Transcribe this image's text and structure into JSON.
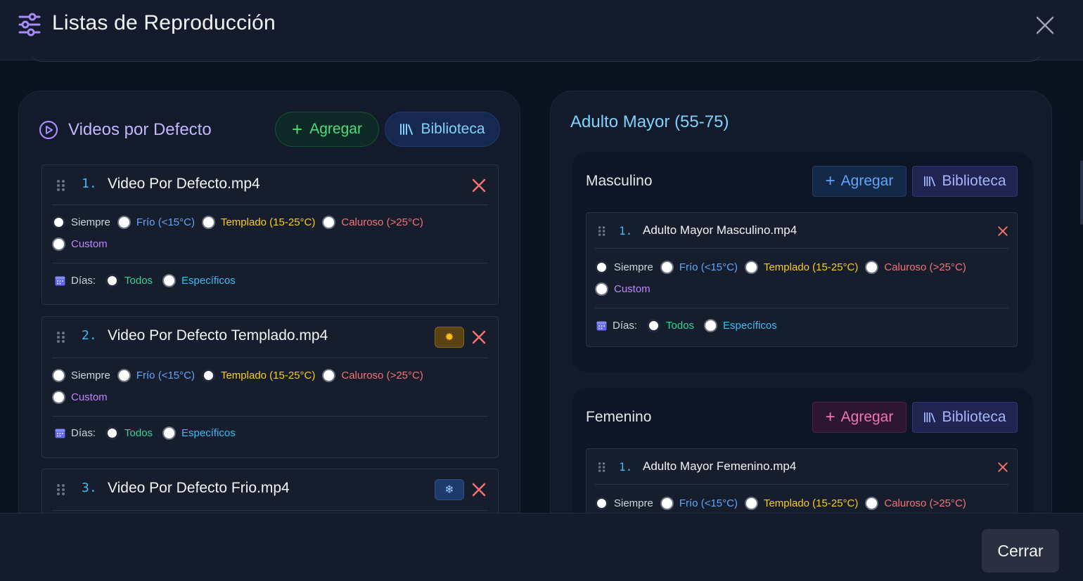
{
  "header": {
    "title": "Listas de Reproducción"
  },
  "weather_options": {
    "siempre": "Siempre",
    "frio": "Frío (<15°C)",
    "templado": "Templado (15-25°C)",
    "caluroso": "Caluroso (>25°C)",
    "custom": "Custom"
  },
  "days_options": {
    "label": "Días:",
    "todos": "Todos",
    "especificos": "Específicos"
  },
  "left_panel": {
    "title": "Videos por Defecto",
    "add_label": "Agregar",
    "library_label": "Biblioteca",
    "videos": [
      {
        "num": "1.",
        "name": "Video Por Defecto.mp4",
        "selected_weather": "siempre",
        "selected_days": "todos",
        "badge": ""
      },
      {
        "num": "2.",
        "name": "Video Por Defecto Templado.mp4",
        "selected_weather": "templado",
        "selected_days": "todos",
        "badge": "sun-icon"
      },
      {
        "num": "3.",
        "name": "Video Por Defecto Frio.mp4",
        "selected_weather": "",
        "selected_days": "",
        "badge": "snowflake-icon"
      }
    ]
  },
  "right_panel": {
    "title": "Adulto Mayor (55-75)",
    "groups": [
      {
        "title": "Masculino",
        "add_label": "Agregar",
        "library_label": "Biblioteca",
        "videos": [
          {
            "num": "1.",
            "name": "Adulto Mayor Masculino.mp4",
            "selected_weather": "siempre",
            "selected_days": "todos"
          }
        ]
      },
      {
        "title": "Femenino",
        "add_label": "Agregar",
        "library_label": "Biblioteca",
        "videos": [
          {
            "num": "1.",
            "name": "Adulto Mayor Femenino.mp4",
            "selected_weather": "siempre",
            "selected_days": ""
          }
        ]
      }
    ]
  },
  "footer": {
    "close_label": "Cerrar"
  }
}
